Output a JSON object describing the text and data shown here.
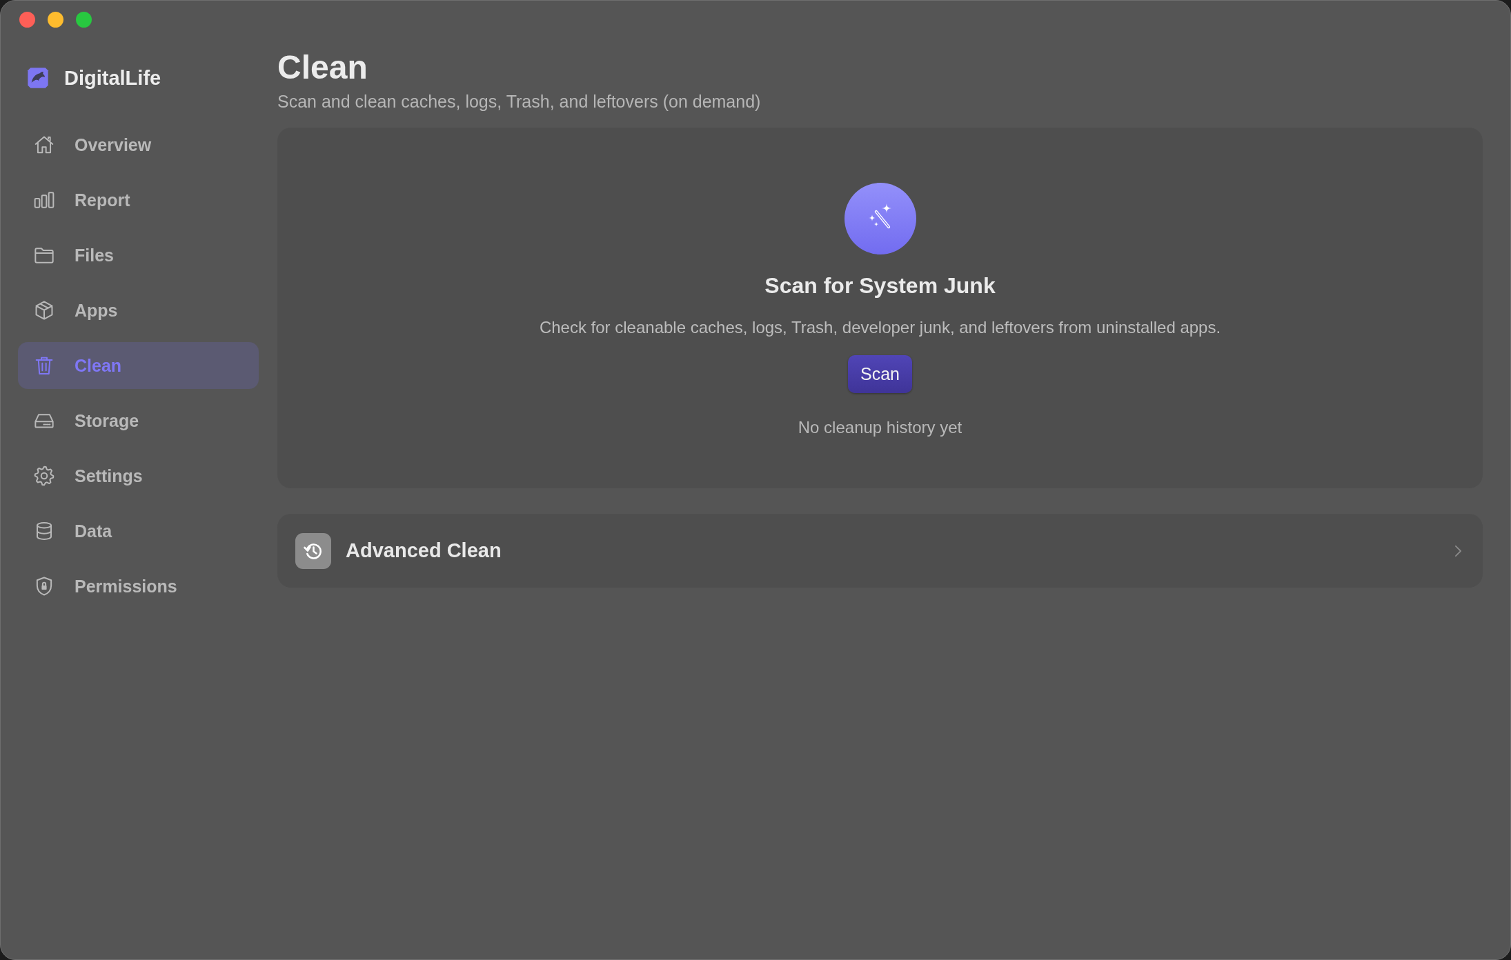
{
  "sidebar": {
    "app_name": "DigitalLife",
    "items": [
      {
        "label": "Overview",
        "selected": false
      },
      {
        "label": "Report",
        "selected": false
      },
      {
        "label": "Files",
        "selected": false
      },
      {
        "label": "Apps",
        "selected": false
      },
      {
        "label": "Clean",
        "selected": true
      },
      {
        "label": "Storage",
        "selected": false
      },
      {
        "label": "Settings",
        "selected": false
      },
      {
        "label": "Data",
        "selected": false
      },
      {
        "label": "Permissions",
        "selected": false
      }
    ]
  },
  "header": {
    "title": "Clean",
    "subtitle": "Scan and clean caches, logs, Trash, and leftovers (on demand)"
  },
  "scan_card": {
    "title": "Scan for System Junk",
    "description": "Check for cleanable caches, logs, Trash, developer junk, and leftovers from uninstalled apps.",
    "button": "Scan",
    "history": "No cleanup history yet"
  },
  "advanced_row": {
    "label": "Advanced Clean"
  }
}
